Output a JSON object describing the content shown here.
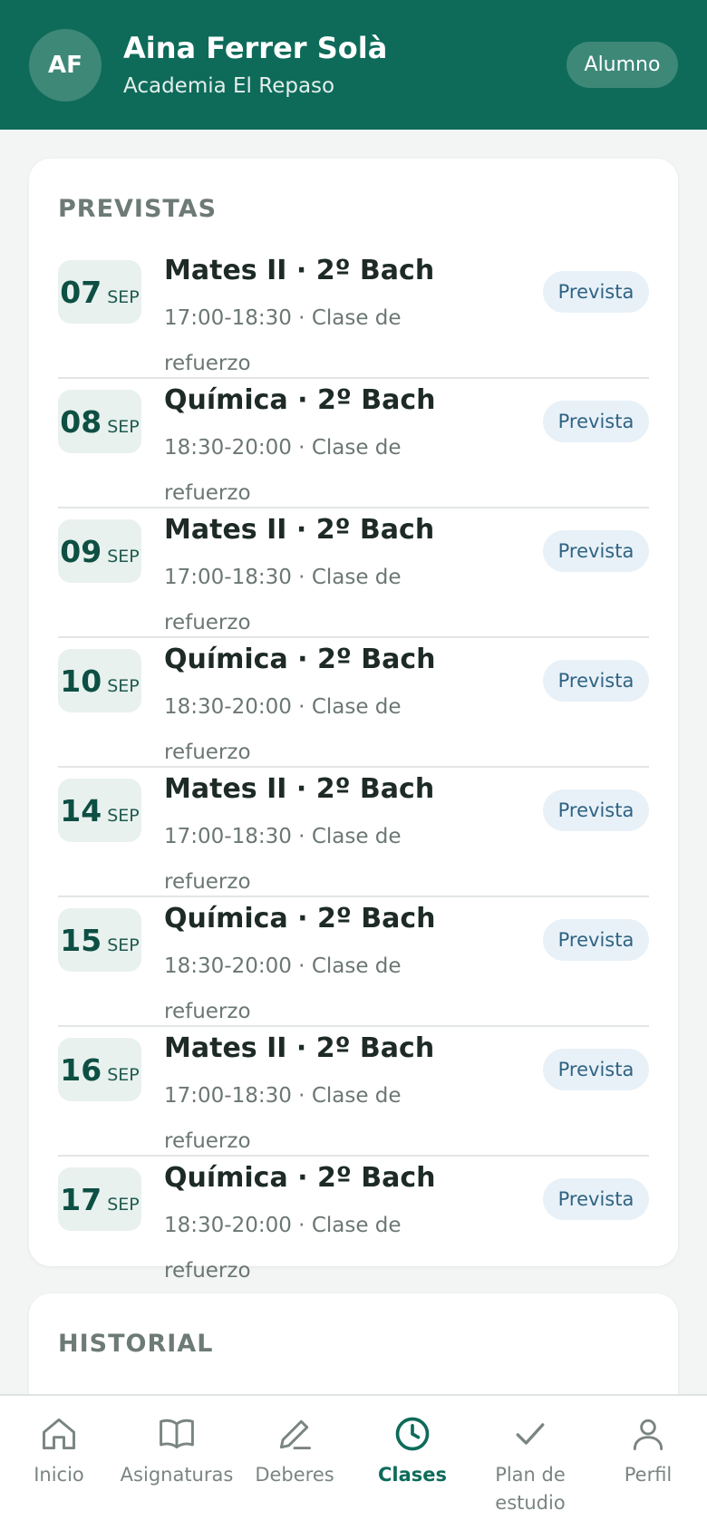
{
  "header": {
    "avatar_initials": "AF",
    "name": "Aina Ferrer Solà",
    "school": "Academia El Repaso",
    "role": "Alumno"
  },
  "upcoming": {
    "title": "PREVISTAS",
    "sessions": [
      {
        "day": "07",
        "month": "SEP",
        "subject": "Mates II · 2º Bach",
        "time": "17:00-18:30",
        "type": "Clase de refuerzo",
        "status": "Prevista"
      },
      {
        "day": "08",
        "month": "SEP",
        "subject": "Química · 2º Bach",
        "time": "18:30-20:00",
        "type": "Clase de refuerzo",
        "status": "Prevista"
      },
      {
        "day": "09",
        "month": "SEP",
        "subject": "Mates II · 2º Bach",
        "time": "17:00-18:30",
        "type": "Clase de refuerzo",
        "status": "Prevista"
      },
      {
        "day": "10",
        "month": "SEP",
        "subject": "Química · 2º Bach",
        "time": "18:30-20:00",
        "type": "Clase de refuerzo",
        "status": "Prevista"
      },
      {
        "day": "14",
        "month": "SEP",
        "subject": "Mates II · 2º Bach",
        "time": "17:00-18:30",
        "type": "Clase de refuerzo",
        "status": "Prevista"
      },
      {
        "day": "15",
        "month": "SEP",
        "subject": "Química · 2º Bach",
        "time": "18:30-20:00",
        "type": "Clase de refuerzo",
        "status": "Prevista"
      },
      {
        "day": "16",
        "month": "SEP",
        "subject": "Mates II · 2º Bach",
        "time": "17:00-18:30",
        "type": "Clase de refuerzo",
        "status": "Prevista"
      },
      {
        "day": "17",
        "month": "SEP",
        "subject": "Química · 2º Bach",
        "time": "18:30-20:00",
        "type": "Clase de refuerzo",
        "status": "Prevista"
      }
    ]
  },
  "history": {
    "title": "HISTORIAL"
  },
  "nav": {
    "items": [
      {
        "label": "Inicio",
        "icon": "home-icon"
      },
      {
        "label": "Asignaturas",
        "icon": "book-icon"
      },
      {
        "label": "Deberes",
        "icon": "pencil-icon"
      },
      {
        "label": "Clases",
        "icon": "clock-icon",
        "active": true
      },
      {
        "label": "Plan de estudio",
        "icon": "check-icon"
      },
      {
        "label": "Perfil",
        "icon": "person-icon"
      }
    ]
  },
  "colors": {
    "brand": "#0e6b5a",
    "status_bg": "#e8f1f8",
    "status_text": "#2f6383"
  }
}
